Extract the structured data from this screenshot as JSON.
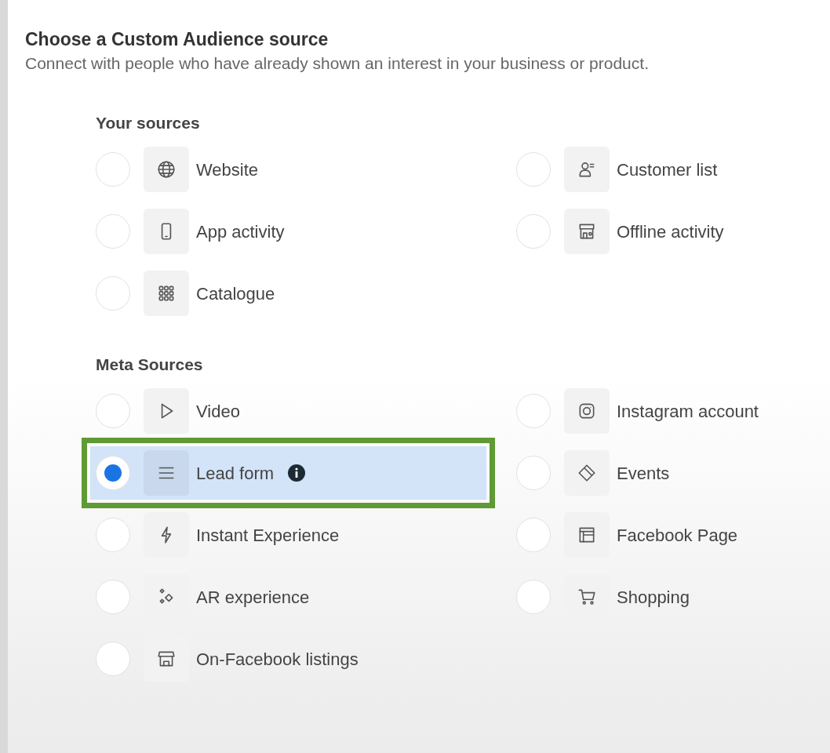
{
  "dialog": {
    "title": "Choose a Custom Audience source",
    "subtitle": "Connect with people who have already shown an interest in your business or product."
  },
  "sections": [
    {
      "heading": "Your sources",
      "items": [
        {
          "label": "Website",
          "selected": false,
          "highlighted": false,
          "has_info": false
        },
        {
          "label": "Customer list",
          "selected": false,
          "highlighted": false,
          "has_info": false
        },
        {
          "label": "App activity",
          "selected": false,
          "highlighted": false,
          "has_info": false
        },
        {
          "label": "Offline activity",
          "selected": false,
          "highlighted": false,
          "has_info": false
        },
        {
          "label": "Catalogue",
          "selected": false,
          "highlighted": false,
          "has_info": false
        }
      ]
    },
    {
      "heading": "Meta Sources",
      "items": [
        {
          "label": "Video",
          "selected": false,
          "highlighted": false,
          "has_info": false
        },
        {
          "label": "Instagram account",
          "selected": false,
          "highlighted": false,
          "has_info": false
        },
        {
          "label": "Lead form",
          "selected": true,
          "highlighted": true,
          "has_info": true
        },
        {
          "label": "Events",
          "selected": false,
          "highlighted": false,
          "has_info": false
        },
        {
          "label": "Instant Experience",
          "selected": false,
          "highlighted": false,
          "has_info": false
        },
        {
          "label": "Facebook Page",
          "selected": false,
          "highlighted": false,
          "has_info": false
        },
        {
          "label": "AR experience",
          "selected": false,
          "highlighted": false,
          "has_info": false
        },
        {
          "label": "Shopping",
          "selected": false,
          "highlighted": false,
          "has_info": false
        },
        {
          "label": "On-Facebook listings",
          "selected": false,
          "highlighted": false,
          "has_info": false
        }
      ]
    }
  ]
}
